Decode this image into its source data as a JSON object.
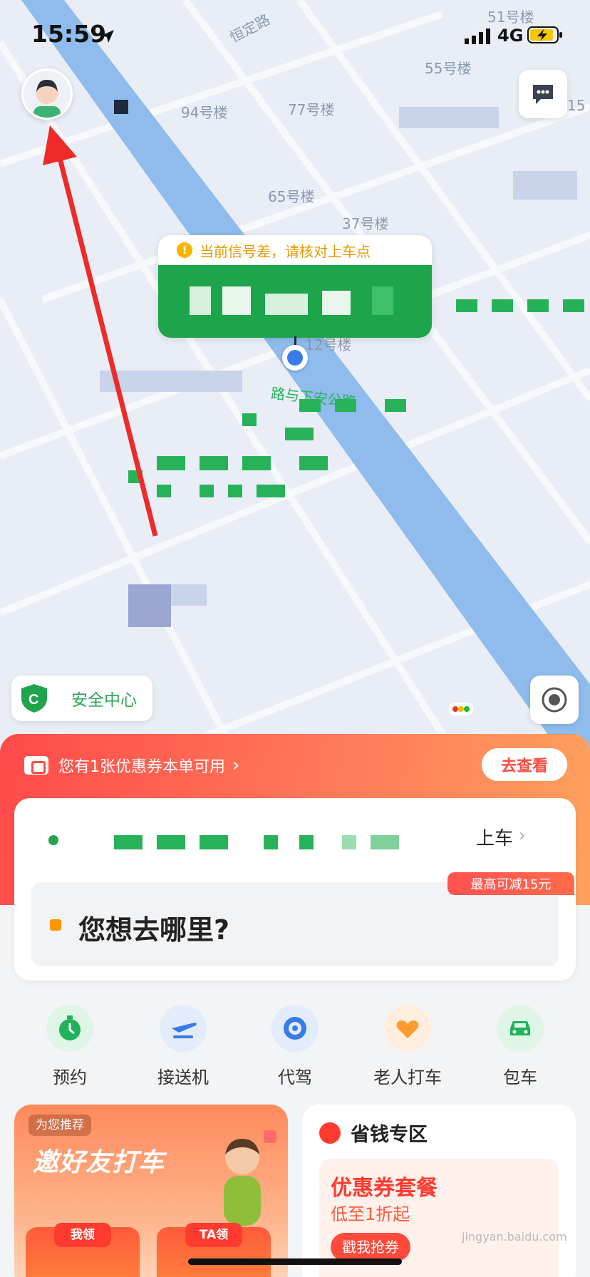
{
  "status_bar": {
    "time": "15:59",
    "network": "4G"
  },
  "map": {
    "street_label": "恒定路",
    "building_labels": [
      "51号楼",
      "55号楼",
      "94号楼",
      "77号楼",
      "65号楼",
      "37号楼",
      "12号楼",
      "15"
    ],
    "road_label": "路与下安公路"
  },
  "pickup_bubble": {
    "warning": "当前信号差，请核对上车点"
  },
  "safety_center": {
    "label": "安全中心"
  },
  "promo": {
    "text": "您有1张优惠券本单可用",
    "button": "去查看"
  },
  "ride_card": {
    "board_label": "上车",
    "destination_placeholder": "您想去哪里?",
    "discount_badge": "最高可减15元"
  },
  "services": [
    {
      "label": "预约",
      "icon": "clock-icon",
      "color": "#1fb25a"
    },
    {
      "label": "接送机",
      "icon": "airplane-icon",
      "color": "#3a7bea"
    },
    {
      "label": "代驾",
      "icon": "steering-wheel-icon",
      "color": "#3a7bea"
    },
    {
      "label": "老人打车",
      "icon": "heart-hands-icon",
      "color": "#ff9b2f"
    },
    {
      "label": "包车",
      "icon": "car-icon",
      "color": "#1fb25a"
    }
  ],
  "recommend_card": {
    "tag": "为您推荐",
    "title": "邀好友打车",
    "coupons": [
      {
        "header": "我领"
      },
      {
        "header": "TA领"
      }
    ]
  },
  "savings_card": {
    "title": "省钱专区",
    "inner_title": "优惠券套餐",
    "inner_subtitle": "低至1折起",
    "button": "戳我抢券",
    "watermark": "jingyan.baidu.com"
  },
  "colors": {
    "brand_green": "#1ea54b",
    "promo_red": "#ff4a4a",
    "annotation_arrow": "#ee2a2a"
  }
}
